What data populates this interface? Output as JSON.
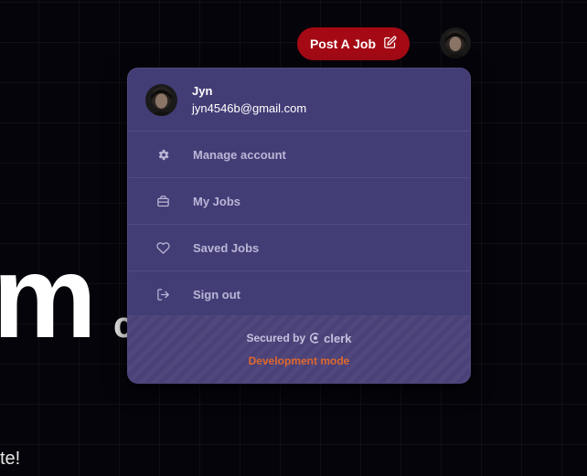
{
  "background": {
    "hero_big": "m",
    "hero_small": "c",
    "hero_tagline": "te!"
  },
  "header": {
    "post_job_label": "Post A Job",
    "post_job_icon": "edit-icon",
    "avatar_icon": "user-avatar"
  },
  "user_menu": {
    "name": "Jyn",
    "email": "jyn4546b@gmail.com",
    "items": [
      {
        "label": "Manage account",
        "icon": "gear-icon"
      },
      {
        "label": "My Jobs",
        "icon": "briefcase-icon"
      },
      {
        "label": "Saved Jobs",
        "icon": "heart-icon"
      },
      {
        "label": "Sign out",
        "icon": "sign-out-icon"
      }
    ],
    "footer": {
      "secured_by": "Secured by",
      "brand": "clerk",
      "dev_mode": "Development mode"
    }
  },
  "colors": {
    "page_bg": "#04040a",
    "accent_button": "#a50a14",
    "popover_bg": "#433d76",
    "dev_mode": "#e0682c"
  }
}
